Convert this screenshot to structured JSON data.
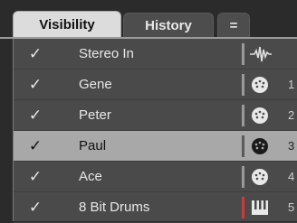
{
  "tabs": {
    "visibility": "Visibility",
    "history": "History",
    "more": "="
  },
  "tracks": [
    {
      "checked": "✓",
      "name": "Stereo In",
      "icon": "audio-waveform-icon",
      "number": ""
    },
    {
      "checked": "✓",
      "name": "Gene",
      "icon": "midi-connector-icon",
      "number": "1"
    },
    {
      "checked": "✓",
      "name": "Peter",
      "icon": "midi-connector-icon",
      "number": "2"
    },
    {
      "checked": "✓",
      "name": "Paul",
      "icon": "midi-connector-icon",
      "number": "3"
    },
    {
      "checked": "✓",
      "name": "Ace",
      "icon": "midi-connector-icon",
      "number": "4"
    },
    {
      "checked": "✓",
      "name": "8 Bit Drums",
      "icon": "instrument-keyboard-icon",
      "number": "5"
    }
  ],
  "selected_track": "Paul",
  "colors": {
    "selected_row": "#a8a8a8",
    "instrument_separator": "#d23a3a"
  }
}
